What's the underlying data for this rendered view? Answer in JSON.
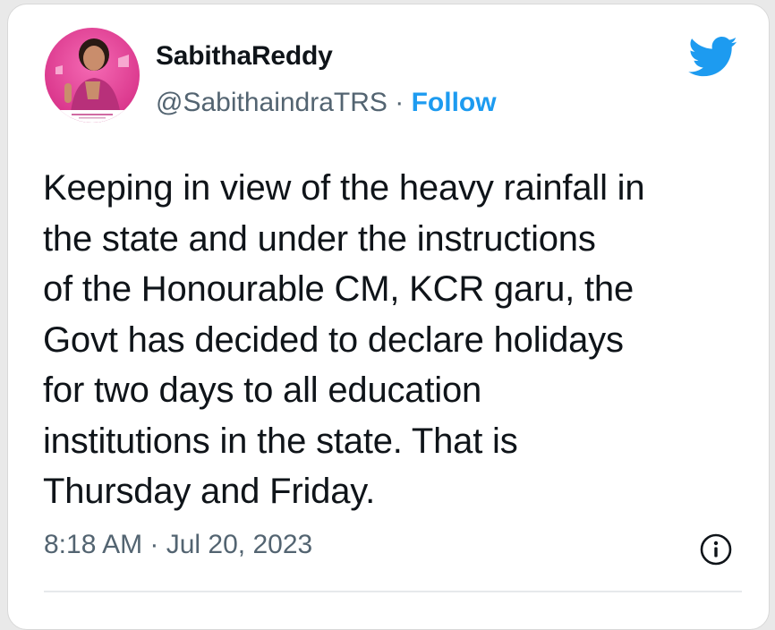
{
  "tweet": {
    "author_name": "SabithaReddy",
    "author_handle": "@SabithaindraTRS",
    "separator": "·",
    "follow_label": "Follow",
    "text": "Keeping in view of the heavy rainfall in\nthe state and under the instructions\nof the Honourable CM, KCR garu, the\nGovt has decided to declare holidays\nfor two days to all education\ninstitutions in the state. That is\nThursday and Friday.",
    "timestamp": "8:18 AM · Jul 20, 2023"
  },
  "icons": {
    "brand": "twitter-bird-icon",
    "info": "info-icon"
  },
  "colors": {
    "accent": "#1d9bf0",
    "text_primary": "#0f1419",
    "text_secondary": "#536471",
    "avatar_bg": "#e5409a"
  }
}
